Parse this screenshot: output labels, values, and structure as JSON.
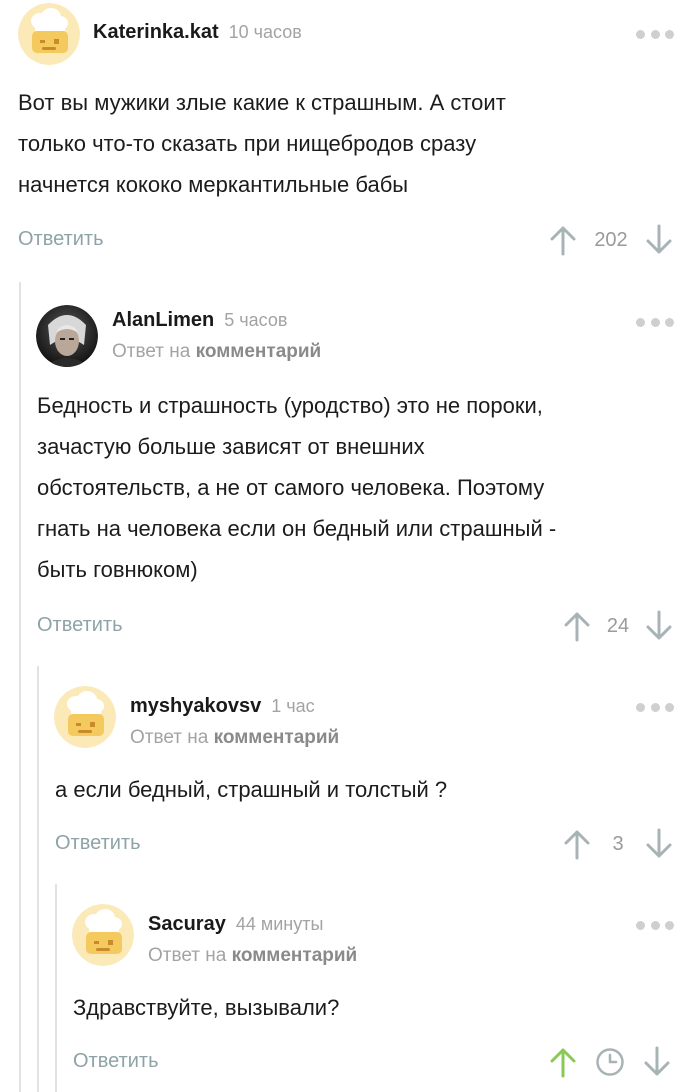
{
  "comments": [
    {
      "author": "Katerinka.kat",
      "time": "10 часов",
      "avatar": "chef-hat-avatar",
      "lines": [
        "Вот вы мужики злые какие к страшным. А стоит",
        "только что-то сказать при нищебродов сразу",
        "начнется кококо меркантильные бабы"
      ],
      "reply_label": "Ответить",
      "rating": "202"
    },
    {
      "author": "AlanLimen",
      "time": "5 часов",
      "avatar": "photo-avatar",
      "reply_prefix": "Ответ на",
      "reply_link": "комментарий",
      "lines": [
        "Бедность и страшность (уродство) это не пороки,",
        "зачастую больше зависят от внешних",
        "обстоятельств, а не от самого человека. Поэтому",
        "гнать на человека если он бедный или страшный -",
        "быть говнюком)"
      ],
      "reply_label": "Ответить",
      "rating": "24"
    },
    {
      "author": "myshyakovsv",
      "time": "1 час",
      "avatar": "chef-hat-avatar",
      "reply_prefix": "Ответ на",
      "reply_link": "комментарий",
      "lines": [
        "а если бедный, страшный и толстый ?"
      ],
      "reply_label": "Ответить",
      "rating": "3"
    },
    {
      "author": "Sacuray",
      "time": "44 минуты",
      "avatar": "chef-hat-avatar",
      "reply_prefix": "Ответ на",
      "reply_link": "комментарий",
      "lines": [
        "Здравствуйте, вызывали?"
      ],
      "reply_label": "Ответить",
      "rating_state": "pending-clock",
      "upvoted": true
    }
  ],
  "colors": {
    "upvote_active": "#8ac858",
    "link": "#8ea3a8",
    "muted": "#a3a3a3",
    "avatar_bg": "#fbe9b8",
    "avatar_face": "#f4c95d"
  }
}
